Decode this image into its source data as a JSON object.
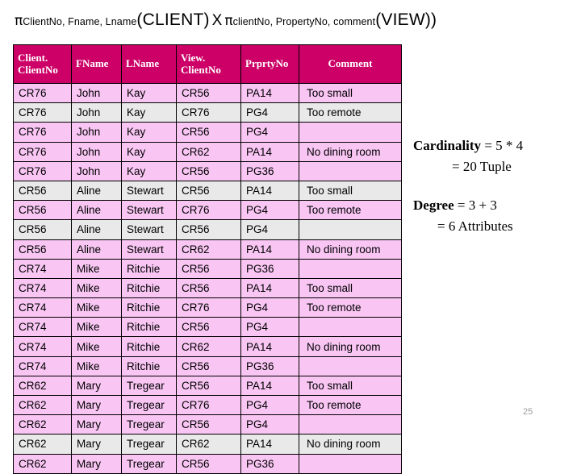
{
  "formula": {
    "pi_symbol": "π",
    "left_subscript": "ClientNo, Fname, Lname",
    "left_relation": "(CLIENT)",
    "operator": "X",
    "right_subscript": "clientNo, PropertyNo, comment",
    "right_relation": "(VIEW))"
  },
  "table": {
    "headers": [
      "Client. ClientNo",
      "FName",
      "LName",
      "View. ClientNo",
      "Prprty No",
      "Comment"
    ],
    "header_lines": {
      "col0_line1": "Client.",
      "col0_line2": "ClientNo",
      "col1": "FName",
      "col2": "LName",
      "col3_line1": "View.",
      "col3_line2": "ClientNo",
      "col4": "PrprtyNo",
      "col5": "Comment"
    },
    "rows": [
      {
        "client_no": "CR76",
        "fname": "John",
        "lname": "Kay",
        "view_client_no": "CR56",
        "property_no": "PA14",
        "comment": "Too small",
        "alt": false
      },
      {
        "client_no": "CR76",
        "fname": "John",
        "lname": "Kay",
        "view_client_no": "CR76",
        "property_no": "PG4",
        "comment": "Too remote",
        "alt": true
      },
      {
        "client_no": "CR76",
        "fname": "John",
        "lname": "Kay",
        "view_client_no": "CR56",
        "property_no": "PG4",
        "comment": "",
        "alt": false
      },
      {
        "client_no": "CR76",
        "fname": "John",
        "lname": "Kay",
        "view_client_no": "CR62",
        "property_no": "PA14",
        "comment": "No dining room",
        "alt": false
      },
      {
        "client_no": "CR76",
        "fname": "John",
        "lname": "Kay",
        "view_client_no": "CR56",
        "property_no": "PG36",
        "comment": "",
        "alt": false
      },
      {
        "client_no": "CR56",
        "fname": "Aline",
        "lname": "Stewart",
        "view_client_no": "CR56",
        "property_no": "PA14",
        "comment": "Too small",
        "alt": true
      },
      {
        "client_no": "CR56",
        "fname": "Aline",
        "lname": "Stewart",
        "view_client_no": "CR76",
        "property_no": "PG4",
        "comment": "Too remote",
        "alt": false
      },
      {
        "client_no": "CR56",
        "fname": "Aline",
        "lname": "Stewart",
        "view_client_no": "CR56",
        "property_no": "PG4",
        "comment": "",
        "alt": true
      },
      {
        "client_no": "CR56",
        "fname": "Aline",
        "lname": "Stewart",
        "view_client_no": "CR62",
        "property_no": "PA14",
        "comment": "No dining room",
        "alt": false
      },
      {
        "client_no": "CR74",
        "fname": "Mike",
        "lname": "Ritchie",
        "view_client_no": "CR56",
        "property_no": "PG36",
        "comment": "",
        "alt": false
      },
      {
        "client_no": "CR74",
        "fname": "Mike",
        "lname": "Ritchie",
        "view_client_no": "CR56",
        "property_no": "PA14",
        "comment": "Too small",
        "alt": false
      },
      {
        "client_no": "CR74",
        "fname": "Mike",
        "lname": "Ritchie",
        "view_client_no": "CR76",
        "property_no": "PG4",
        "comment": "Too remote",
        "alt": false
      },
      {
        "client_no": "CR74",
        "fname": "Mike",
        "lname": "Ritchie",
        "view_client_no": "CR56",
        "property_no": "PG4",
        "comment": "",
        "alt": false
      },
      {
        "client_no": "CR74",
        "fname": "Mike",
        "lname": "Ritchie",
        "view_client_no": "CR62",
        "property_no": "PA14",
        "comment": "No dining room",
        "alt": false
      },
      {
        "client_no": "CR74",
        "fname": "Mike",
        "lname": "Ritchie",
        "view_client_no": "CR56",
        "property_no": "PG36",
        "comment": "",
        "alt": false
      },
      {
        "client_no": "CR62",
        "fname": "Mary",
        "lname": "Tregear",
        "view_client_no": "CR56",
        "property_no": "PA14",
        "comment": "Too small",
        "alt": false
      },
      {
        "client_no": "CR62",
        "fname": "Mary",
        "lname": "Tregear",
        "view_client_no": "CR76",
        "property_no": "PG4",
        "comment": "Too remote",
        "alt": false
      },
      {
        "client_no": "CR62",
        "fname": "Mary",
        "lname": "Tregear",
        "view_client_no": "CR56",
        "property_no": "PG4",
        "comment": "",
        "alt": false
      },
      {
        "client_no": "CR62",
        "fname": "Mary",
        "lname": "Tregear",
        "view_client_no": "CR62",
        "property_no": "PA14",
        "comment": "No dining room",
        "alt": true
      },
      {
        "client_no": "CR62",
        "fname": "Mary",
        "lname": "Tregear",
        "view_client_no": "CR56",
        "property_no": "PG36",
        "comment": "",
        "alt": false
      }
    ]
  },
  "annotations": {
    "cardinality_label": "Cardinality",
    "cardinality_expr": "= 5 * 4",
    "cardinality_result": "= 20 Tuple",
    "degree_label": "Degree",
    "degree_expr": "= 3 + 3",
    "degree_result": "= 6 Attributes"
  },
  "page_number": "25",
  "colors": {
    "header_bg": "#CC0066",
    "row_bg": "#F9C6F4",
    "row_alt_bg": "#E9E9E9",
    "border": "#000000",
    "text": "#000000",
    "page_number": "#9a9a9a"
  }
}
